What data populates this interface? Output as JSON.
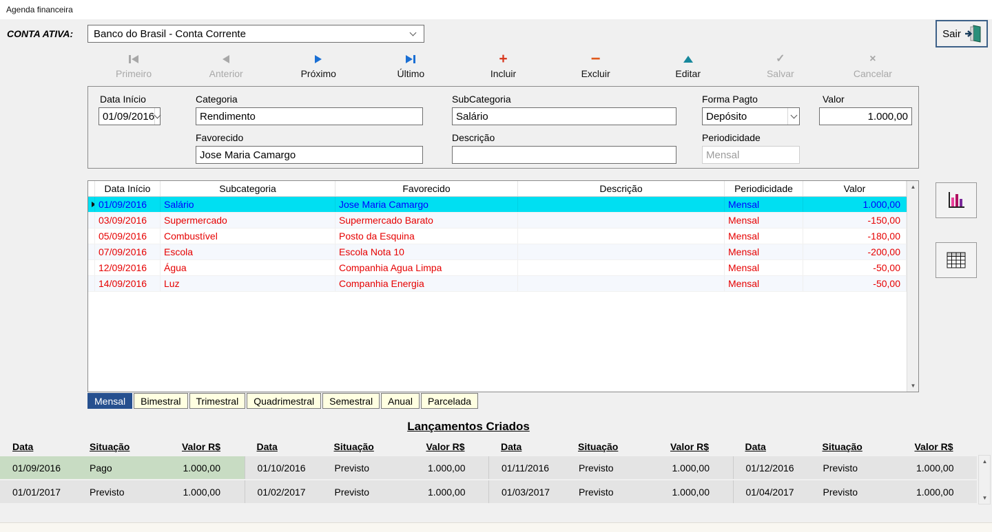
{
  "window": {
    "title": "Agenda financeira"
  },
  "account": {
    "label": "CONTA ATIVA:",
    "value": "Banco do Brasil - Conta Corrente"
  },
  "exit": {
    "label": "Sair"
  },
  "toolbar": {
    "items": [
      {
        "label": "Primeiro",
        "icon": "first-record-icon",
        "enabled": false
      },
      {
        "label": "Anterior",
        "icon": "previous-record-icon",
        "enabled": false
      },
      {
        "label": "Próximo",
        "icon": "next-record-icon",
        "enabled": true
      },
      {
        "label": "Último",
        "icon": "last-record-icon",
        "enabled": true
      },
      {
        "label": "Incluir",
        "icon": "add-icon",
        "enabled": true
      },
      {
        "label": "Excluir",
        "icon": "remove-icon",
        "enabled": true
      },
      {
        "label": "Editar",
        "icon": "edit-icon",
        "enabled": true
      },
      {
        "label": "Salvar",
        "icon": "save-check-icon",
        "enabled": false
      },
      {
        "label": "Cancelar",
        "icon": "cancel-x-icon",
        "enabled": false
      }
    ]
  },
  "form": {
    "data_inicio": {
      "label": "Data Início",
      "value": "01/09/2016"
    },
    "categoria": {
      "label": "Categoria",
      "value": "Rendimento"
    },
    "subcategoria": {
      "label": "SubCategoria",
      "value": "Salário"
    },
    "forma_pagto": {
      "label": "Forma Pagto",
      "value": "Depósito"
    },
    "valor": {
      "label": "Valor",
      "value": "1.000,00"
    },
    "favorecido": {
      "label": "Favorecido",
      "value": "Jose Maria Camargo"
    },
    "descricao": {
      "label": "Descrição",
      "value": ""
    },
    "periodicidade": {
      "label": "Periodicidade",
      "value": "Mensal"
    }
  },
  "grid": {
    "columns": [
      "Data Início",
      "Subcategoria",
      "Favorecido",
      "Descrição",
      "Periodicidade",
      "Valor"
    ],
    "rows": [
      {
        "data": "01/09/2016",
        "subcategoria": "Salário",
        "favorecido": "Jose Maria Camargo",
        "descricao": "",
        "periodicidade": "Mensal",
        "valor": "1.000,00",
        "selected": true
      },
      {
        "data": "03/09/2016",
        "subcategoria": "Supermercado",
        "favorecido": "Supermercado Barato",
        "descricao": "",
        "periodicidade": "Mensal",
        "valor": "-150,00",
        "selected": false
      },
      {
        "data": "05/09/2016",
        "subcategoria": "Combustível",
        "favorecido": "Posto da Esquina",
        "descricao": "",
        "periodicidade": "Mensal",
        "valor": "-180,00",
        "selected": false
      },
      {
        "data": "07/09/2016",
        "subcategoria": "Escola",
        "favorecido": "Escola Nota 10",
        "descricao": "",
        "periodicidade": "Mensal",
        "valor": "-200,00",
        "selected": false
      },
      {
        "data": "12/09/2016",
        "subcategoria": "Água",
        "favorecido": "Companhia Agua Limpa",
        "descricao": "",
        "periodicidade": "Mensal",
        "valor": "-50,00",
        "selected": false
      },
      {
        "data": "14/09/2016",
        "subcategoria": "Luz",
        "favorecido": "Companhia Energia",
        "descricao": "",
        "periodicidade": "Mensal",
        "valor": "-50,00",
        "selected": false
      }
    ]
  },
  "tabs": [
    {
      "label": "Mensal",
      "selected": true
    },
    {
      "label": "Bimestral",
      "selected": false
    },
    {
      "label": "Trimestral",
      "selected": false
    },
    {
      "label": "Quadrimestral",
      "selected": false
    },
    {
      "label": "Semestral",
      "selected": false
    },
    {
      "label": "Anual",
      "selected": false
    },
    {
      "label": "Parcelada",
      "selected": false
    }
  ],
  "lanc": {
    "title": "Lançamentos Criados",
    "headers": [
      "Data",
      "Situação",
      "Valor R$"
    ],
    "rows": [
      [
        {
          "data": "01/09/2016",
          "situacao": "Pago",
          "valor": "1.000,00",
          "paid": true
        },
        {
          "data": "01/10/2016",
          "situacao": "Previsto",
          "valor": "1.000,00",
          "paid": false
        },
        {
          "data": "01/11/2016",
          "situacao": "Previsto",
          "valor": "1.000,00",
          "paid": false
        },
        {
          "data": "01/12/2016",
          "situacao": "Previsto",
          "valor": "1.000,00",
          "paid": false
        }
      ],
      [
        {
          "data": "01/01/2017",
          "situacao": "Previsto",
          "valor": "1.000,00",
          "paid": false
        },
        {
          "data": "01/02/2017",
          "situacao": "Previsto",
          "valor": "1.000,00",
          "paid": false
        },
        {
          "data": "01/03/2017",
          "situacao": "Previsto",
          "valor": "1.000,00",
          "paid": false
        },
        {
          "data": "01/04/2017",
          "situacao": "Previsto",
          "valor": "1.000,00",
          "paid": false
        }
      ]
    ]
  },
  "colors": {
    "selected_row_bg": "#00dff2",
    "selected_row_text": "#0000ff",
    "expense_text": "#e60000",
    "tab_selected_bg": "#26508f",
    "paid_cell_bg": "#c8dcc3",
    "enabled_arrow_blue": "#1a6fd4",
    "add_icon_red": "#d93a20",
    "remove_icon_orange": "#e0591c",
    "edit_icon_teal": "#17889c"
  }
}
